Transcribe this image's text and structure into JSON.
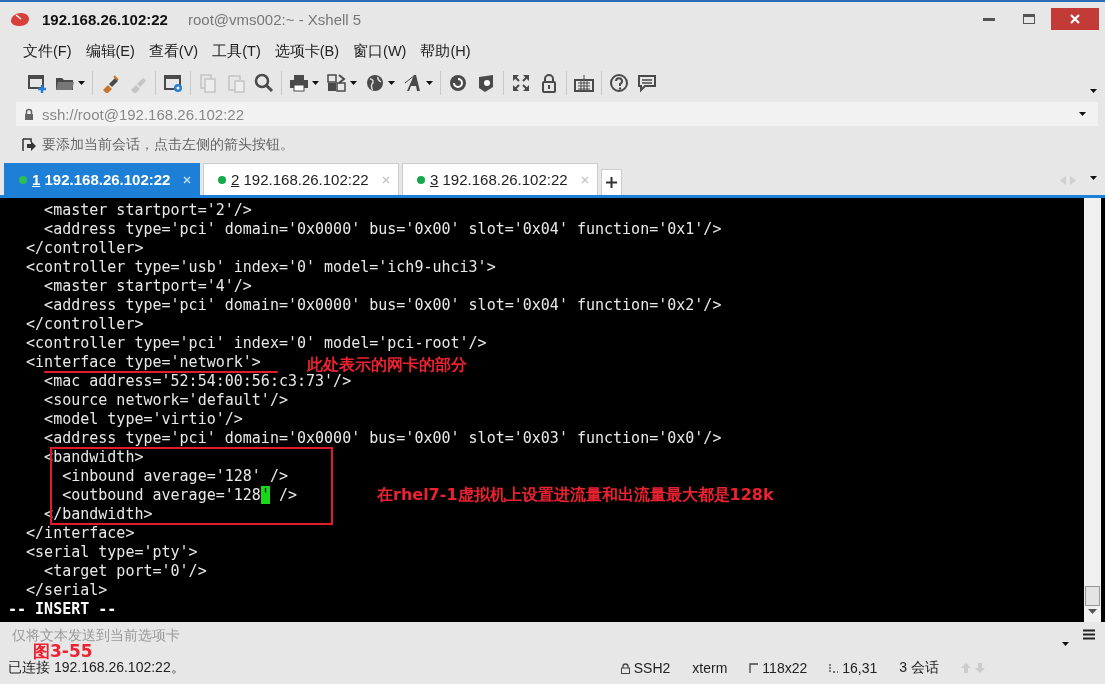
{
  "window": {
    "host": "192.168.26.102:22",
    "title": "root@vms002:~ - Xshell 5"
  },
  "menu": [
    "文件(F)",
    "编辑(E)",
    "查看(V)",
    "工具(T)",
    "选项卡(B)",
    "窗口(W)",
    "帮助(H)"
  ],
  "toolbar": [
    [
      {
        "kind": "new",
        "dropdown": false,
        "disabled": false
      },
      {
        "kind": "open",
        "dropdown": true,
        "disabled": false
      }
    ],
    [
      {
        "kind": "connect",
        "dropdown": false,
        "disabled": false
      },
      {
        "kind": "disconnect",
        "dropdown": false,
        "disabled": true
      }
    ],
    [
      {
        "kind": "properties",
        "dropdown": false,
        "disabled": false
      }
    ],
    [
      {
        "kind": "copy",
        "dropdown": false,
        "disabled": true
      },
      {
        "kind": "paste",
        "dropdown": false,
        "disabled": true
      },
      {
        "kind": "find",
        "dropdown": false,
        "disabled": false
      }
    ],
    [
      {
        "kind": "print",
        "dropdown": true,
        "disabled": false
      },
      {
        "kind": "transfer",
        "dropdown": true,
        "disabled": false
      },
      {
        "kind": "globe",
        "dropdown": true,
        "disabled": false
      },
      {
        "kind": "font",
        "dropdown": true,
        "disabled": false
      }
    ],
    [
      {
        "kind": "xftp",
        "dropdown": false,
        "disabled": false
      },
      {
        "kind": "xmanager",
        "dropdown": false,
        "disabled": false
      }
    ],
    [
      {
        "kind": "fullscreen",
        "dropdown": false,
        "disabled": false
      },
      {
        "kind": "lock",
        "dropdown": false,
        "disabled": false
      }
    ],
    [
      {
        "kind": "keyboard",
        "dropdown": false,
        "disabled": false
      }
    ],
    [
      {
        "kind": "help",
        "dropdown": false,
        "disabled": false
      },
      {
        "kind": "chat",
        "dropdown": false,
        "disabled": false
      }
    ]
  ],
  "address": {
    "value": "ssh://root@192.168.26.102:22"
  },
  "hint": {
    "text": "要添加当前会话，点击左侧的箭头按钮。"
  },
  "tabs": [
    {
      "number": "1",
      "label": "192.168.26.102:22",
      "selected": true
    },
    {
      "number": "2",
      "label": "192.168.26.102:22",
      "selected": false
    },
    {
      "number": "3",
      "label": "192.168.26.102:22",
      "selected": false
    }
  ],
  "terminal": {
    "lines": [
      {
        "kind": "text",
        "text": "    <master startport='2'/>"
      },
      {
        "kind": "text",
        "text": "    <address type='pci' domain='0x0000' bus='0x00' slot='0x04' function='0x1'/>"
      },
      {
        "kind": "text",
        "text": "  </controller>"
      },
      {
        "kind": "text",
        "text": "  <controller type='usb' index='0' model='ich9-uhci3'>"
      },
      {
        "kind": "text",
        "text": "    <master startport='4'/>"
      },
      {
        "kind": "text",
        "text": "    <address type='pci' domain='0x0000' bus='0x00' slot='0x04' function='0x2'/>"
      },
      {
        "kind": "text",
        "text": "  </controller>"
      },
      {
        "kind": "text",
        "text": "  <controller type='pci' index='0' model='pci-root'/>"
      },
      {
        "kind": "text",
        "text": "  <interface type='network'>"
      },
      {
        "kind": "text",
        "text": "    <mac address='52:54:00:56:c3:73'/>"
      },
      {
        "kind": "text",
        "text": "    <source network='default'/>"
      },
      {
        "kind": "text",
        "text": "    <model type='virtio'/>"
      },
      {
        "kind": "text",
        "text": "    <address type='pci' domain='0x0000' bus='0x00' slot='0x03' function='0x0'/>"
      },
      {
        "kind": "text",
        "text": "    <bandwidth>"
      },
      {
        "kind": "text",
        "text": "      <inbound average='128' />"
      },
      {
        "kind": "cursor",
        "before": "      <outbound average='128",
        "cursor": "'",
        "after": " />"
      },
      {
        "kind": "text",
        "text": "    </bandwidth>"
      },
      {
        "kind": "text",
        "text": "  </interface>"
      },
      {
        "kind": "text",
        "text": "  <serial type='pty'>"
      },
      {
        "kind": "text",
        "text": "    <target port='0'/>"
      },
      {
        "kind": "text",
        "text": "  </serial>"
      },
      {
        "kind": "mode",
        "text": "-- INSERT --"
      }
    ]
  },
  "annotations": [
    {
      "kind": "underline",
      "text": "此处表示的网卡的部分"
    },
    {
      "kind": "box",
      "text": "在rhel7-1虚拟机上设置进流量和出流量最大都是128k"
    }
  ],
  "figure_label": "图3-55",
  "compose": {
    "placeholder": "仅将文本发送到当前选项卡"
  },
  "status": {
    "connection": "已连接 192.168.26.102:22。",
    "protocol": "SSH2",
    "terminal": "xterm",
    "size": "118x22",
    "cursor": "16,31",
    "sessions": "3 会话"
  }
}
